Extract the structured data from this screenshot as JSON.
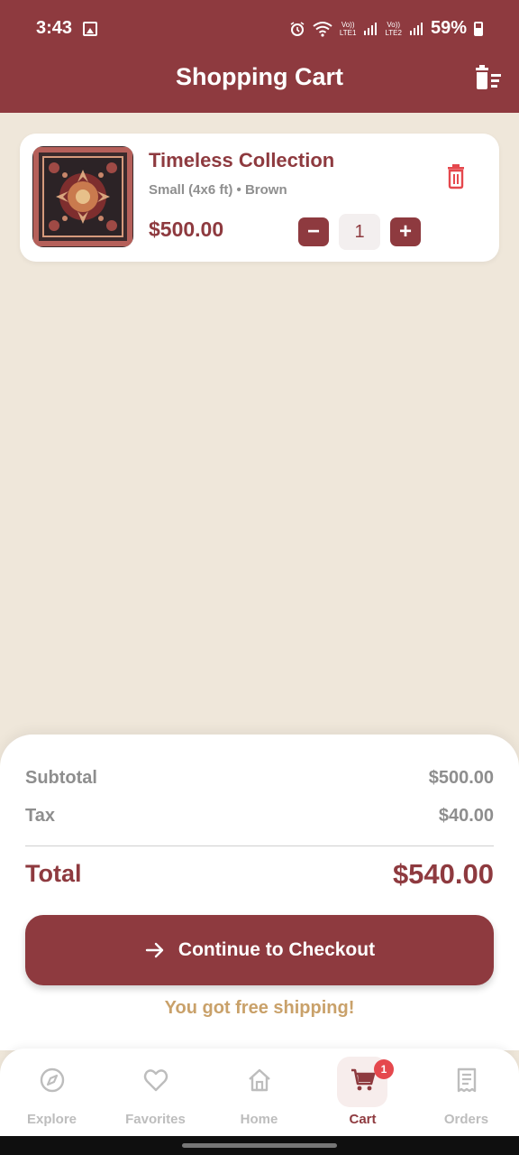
{
  "status_bar": {
    "time": "3:43",
    "battery": "59%",
    "sim1_top": "Vo))",
    "sim1_bottom": "LTE1",
    "sim2_top": "Vo))",
    "sim2_bottom": "LTE2",
    "icons": [
      "image-icon",
      "alarm-icon",
      "wifi-icon",
      "signal-icon",
      "battery-icon"
    ]
  },
  "header": {
    "title": "Shopping Cart",
    "clear_icon": "clear-cart-icon"
  },
  "cart": {
    "items": [
      {
        "title": "Timeless Collection",
        "variant": "Small (4x6 ft) • Brown",
        "price": "$500.00",
        "quantity": "1",
        "minus_label": "−",
        "plus_label": "+",
        "image_icon": "rug-image"
      }
    ]
  },
  "summary": {
    "subtotal_label": "Subtotal",
    "subtotal_value": "$500.00",
    "tax_label": "Tax",
    "tax_value": "$40.00",
    "total_label": "Total",
    "total_value": "$540.00",
    "checkout_label": "Continue to Checkout",
    "free_shipping": "You got free shipping!"
  },
  "nav": {
    "items": [
      {
        "label": "Explore",
        "icon": "compass-icon"
      },
      {
        "label": "Favorites",
        "icon": "heart-icon"
      },
      {
        "label": "Home",
        "icon": "home-icon"
      },
      {
        "label": "Cart",
        "icon": "cart-icon",
        "active": true,
        "badge": "1"
      },
      {
        "label": "Orders",
        "icon": "receipt-icon"
      }
    ]
  },
  "colors": {
    "primary": "#8E3A3F",
    "background": "#EFE7DA",
    "accent": "#C9A16A",
    "badge": "#E5484D",
    "delete": "#E5484D"
  }
}
